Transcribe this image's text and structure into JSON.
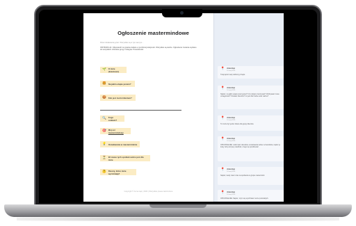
{
  "document": {
    "title": "Ogłoszenie mastermindowe",
    "subtitle": "Dzień dodawania pytań. Wszystkie są w tym samym...",
    "intro": "INSTRUKCJA: Odpowiedz na pytania zadane w poniższej kolejności. Wszystkie są ważne. Ogłoszenie zostanie wysłane do wszystkich członków grupy i kolegów. Powodzenia!",
    "items_top": [
      {
        "icon": "🌱",
        "label": "O mnie (branżowo)"
      },
      {
        "icon": "🍔",
        "label": "Na jakim etapie jestem?"
      },
      {
        "icon": "🍪",
        "label": "Kim jest moim klientem?"
      }
    ],
    "items_bottom": [
      {
        "icon": "🔍",
        "label": "Kogo szukam?"
      },
      {
        "icon": "🎯",
        "label_prefix": "Mój cel ",
        "label_link": "mastermindowy"
      },
      {
        "icon": "💡",
        "label": "Oczekiwania w mastermindzie"
      },
      {
        "icon": "⏳",
        "label": "W czasie tych spotkań wolno jest dla mnie"
      },
      {
        "icon": "🤔",
        "label": "Rzeczy, które mnie wyróżniają?"
      }
    ],
    "footer": "Copyright © Anna Gąś | 2020 | Wszystkie prawa zastrzeżone"
  },
  "comments": [
    {
      "author": "Anna Gąś",
      "date": "10 maj 2020",
      "text": "Tutaj wpisz swój ulubiony przepis."
    },
    {
      "author": "Anna Gąś",
      "date": "10 maj 2020",
      "text": "Napisz, na jakim etapie teraz jesteś? Czy dopiero zaczynasz? Zdobywasz nowe umiejętności? Szukasz klientów? Co jest dla Ciebie teraz ważne?"
    },
    {
      "author": "Anna Gąś",
      "date": "10 maj 2020",
      "text": "To może być jedno zdanie dla grupy klientów."
    },
    {
      "author": "Anna Gąś",
      "date": "10 maj 2020",
      "text": "OPCJONALNIE: Jeśli masz określone oczekiwania wobec uczestników, napisz je tutaj, żeby wszyscy wiedzieli, czego się spodziewać."
    },
    {
      "author": "Anna Gąś",
      "date": "10 maj 2020",
      "text": "Napisz, kiedy masz czas na spotkania w grupie mastermind."
    },
    {
      "author": "Anna Gąś",
      "date": "10 maj 2020",
      "text": "OPCJONALNIE: Napisz, czym się wyróżniasz na tle pozostałych."
    }
  ]
}
